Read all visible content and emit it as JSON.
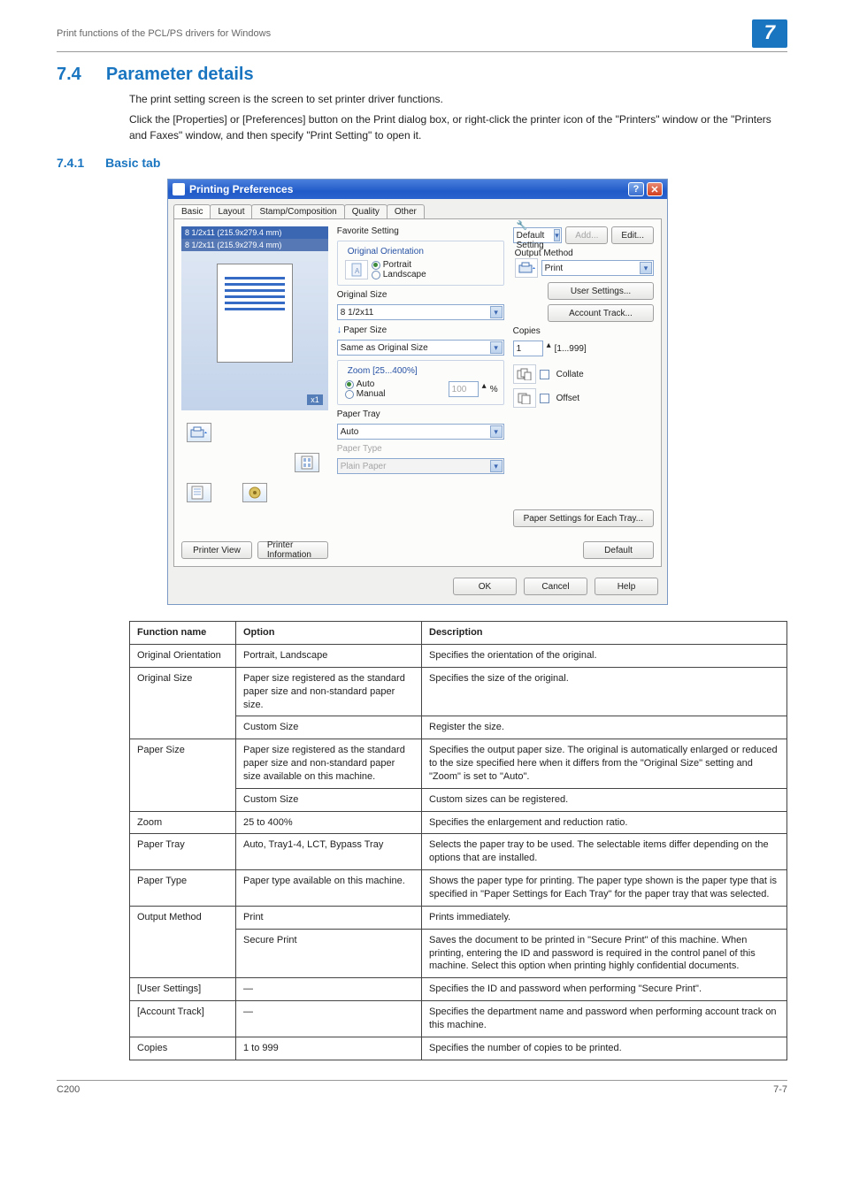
{
  "header": {
    "breadcrumb": "Print functions of the PCL/PS drivers for Windows",
    "chapter": "7"
  },
  "section": {
    "num": "7.4",
    "title": "Parameter details",
    "intro1": "The print setting screen is the screen to set printer driver functions.",
    "intro2": "Click the [Properties] or [Preferences] button on the Print dialog box, or right-click the printer icon of the \"Printers\" window or the \"Printers and Faxes\" window, and then specify \"Print Setting\" to open it."
  },
  "sub": {
    "num": "7.4.1",
    "title": "Basic tab"
  },
  "dialog": {
    "title": "Printing Preferences",
    "tabs": [
      "Basic",
      "Layout",
      "Stamp/Composition",
      "Quality",
      "Other"
    ],
    "preview": {
      "outsize": "8 1/2x11 (215.9x279.4 mm)",
      "insize": "8 1/2x11 (215.9x279.4 mm)",
      "scale": "x1"
    },
    "leftButtons": {
      "printerView": "Printer View",
      "printerInfo": "Printer Information"
    },
    "favorite": {
      "label": "Favorite Setting",
      "value": "Default Setting",
      "add": "Add...",
      "edit": "Edit..."
    },
    "orient": {
      "title": "Original Orientation",
      "portrait": "Portrait",
      "landscape": "Landscape"
    },
    "origsize": {
      "label": "Original Size",
      "value": "8 1/2x11"
    },
    "papersize": {
      "label": "Paper Size",
      "value": "Same as Original Size"
    },
    "zoom": {
      "title": "Zoom [25...400%]",
      "auto": "Auto",
      "manual": "Manual",
      "value": "100",
      "pct": "%"
    },
    "tray": {
      "label": "Paper Tray",
      "value": "Auto"
    },
    "ptype": {
      "label": "Paper Type",
      "value": "Plain Paper"
    },
    "output": {
      "label": "Output Method",
      "value": "Print"
    },
    "sidebtns": {
      "user": "User Settings...",
      "account": "Account Track..."
    },
    "copies": {
      "label": "Copies",
      "value": "1",
      "range": "[1...999]",
      "collate": "Collate",
      "offset": "Offset"
    },
    "eachTray": "Paper Settings for Each Tray...",
    "default": "Default",
    "ok": "OK",
    "cancel": "Cancel",
    "help": "Help"
  },
  "table": {
    "head": {
      "fn": "Function name",
      "op": "Option",
      "desc": "Description"
    },
    "rows": [
      {
        "fn": "Original Orientation",
        "op": "Portrait, Landscape",
        "desc": "Specifies the orientation of the original.",
        "rs": 1
      },
      {
        "fn": "Original Size",
        "op": "Paper size registered as the standard paper size and non-standard paper size.",
        "desc": "Specifies the size of the original.",
        "rs": 2,
        "op2": "Custom Size",
        "desc2": "Register the size."
      },
      {
        "fn": "Paper Size",
        "op": "Paper size registered as the standard paper size and non-standard paper size available on this machine.",
        "desc": "Specifies the output paper size. The original is automatically enlarged or reduced to the size specified here when it differs from the \"Original Size\" setting and \"Zoom\" is set to \"Auto\".",
        "rs": 2,
        "op2": "Custom Size",
        "desc2": "Custom sizes can be registered."
      },
      {
        "fn": "Zoom",
        "op": "25 to 400%",
        "desc": "Specifies the enlargement and reduction ratio.",
        "rs": 1
      },
      {
        "fn": "Paper Tray",
        "op": "Auto, Tray1-4, LCT, Bypass Tray",
        "desc": "Selects the paper tray to be used.\nThe selectable items differ depending on the options that are installed.",
        "rs": 1
      },
      {
        "fn": "Paper Type",
        "op": "Paper type available on this machine.",
        "desc": "Shows the paper type for printing. The paper type shown is the paper type that is specified in \"Paper Settings for Each Tray\" for the paper tray that was selected.",
        "rs": 1
      },
      {
        "fn": "Output Method",
        "op": "Print",
        "desc": "Prints immediately.",
        "rs": 2,
        "op2": "Secure Print",
        "desc2": "Saves the document to be printed in \"Secure Print\" of this machine. When printing, entering the ID and password is required in the control panel of this machine. Select this option when printing highly confidential documents."
      },
      {
        "fn": "[User Settings]",
        "op": "—",
        "desc": "Specifies the ID and password when performing \"Secure Print\".",
        "rs": 1
      },
      {
        "fn": "[Account Track]",
        "op": "—",
        "desc": "Specifies the department name and password when performing account track on this machine.",
        "rs": 1
      },
      {
        "fn": "Copies",
        "op": "1 to 999",
        "desc": "Specifies the number of copies to be printed.",
        "rs": 1
      }
    ]
  },
  "footer": {
    "model": "C200",
    "page": "7-7"
  }
}
